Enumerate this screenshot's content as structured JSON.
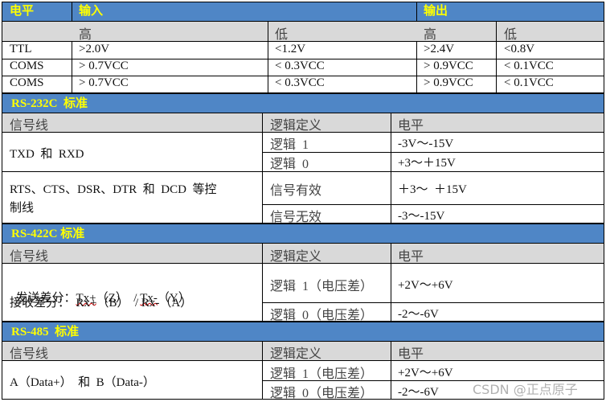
{
  "level_table": {
    "header": {
      "level": "电平",
      "input": "输入",
      "output": "输出"
    },
    "subheader": {
      "input_high": "高",
      "input_low": "低",
      "output_high": "高",
      "output_low": "低"
    },
    "rows": [
      {
        "name": "TTL",
        "in_high": ">2.0V",
        "in_low": "<1.2V",
        "out_high": ">2.4V",
        "out_low": "<0.8V"
      },
      {
        "name": "COMS",
        "in_high": "> 0.7VCC",
        "in_low": "< 0.3VCC",
        "out_high": "> 0.9VCC",
        "out_low": "< 0.1VCC"
      },
      {
        "name": "COMS",
        "in_high": "> 0.7VCC",
        "in_low": "< 0.3VCC",
        "out_high": "> 0.9VCC",
        "out_low": "< 0.1VCC"
      }
    ]
  },
  "rs232": {
    "title": "RS-232C  标准",
    "columns": [
      "信号线",
      "逻辑定义",
      "电平"
    ],
    "groups": [
      {
        "signal": "TXD  和  RXD",
        "rows": [
          {
            "logic": "逻辑  1",
            "level": "-3V～-15V"
          },
          {
            "logic": "逻辑  0",
            "level": "+3～＋15V"
          }
        ]
      },
      {
        "signal_line1": "RTS、CTS、DSR、DTR  和  DCD  等控",
        "signal_line2": "制线",
        "rows": [
          {
            "logic": "信号有效",
            "level": "＋3～  ＋15V"
          },
          {
            "logic": "信号无效",
            "level": "-3～-15V"
          }
        ]
      }
    ]
  },
  "rs422": {
    "title": "RS-422C 标准",
    "columns": [
      "信号线",
      "逻辑定义",
      "电平"
    ],
    "signal_line1_prefix": "发送差分：",
    "signal_line1_tx_plus": "Tx+",
    "signal_line1_mid": "（Z）  /",
    "signal_line1_tx_minus": "Tx-",
    "signal_line1_suffix": "（Y）",
    "signal_line2": "接收差分：  Rx+（B）  / Rx-（A）",
    "rows": [
      {
        "logic": "逻辑  1（电压差）",
        "level": "+2V～+6V"
      },
      {
        "logic": "逻辑  0（电压差）",
        "level": "-2～-6V"
      }
    ]
  },
  "rs485": {
    "title": "RS-485  标准",
    "columns": [
      "信号线",
      "逻辑定义",
      "电平"
    ],
    "signal": "A（Data+）  和  B（Data-）",
    "rows": [
      {
        "logic": "逻辑  1（电压差）",
        "level": "+2V～+6V"
      },
      {
        "logic": "逻辑  0（电压差）",
        "level": "-2～-6V"
      }
    ]
  },
  "watermark": "CSDN @正点原子"
}
